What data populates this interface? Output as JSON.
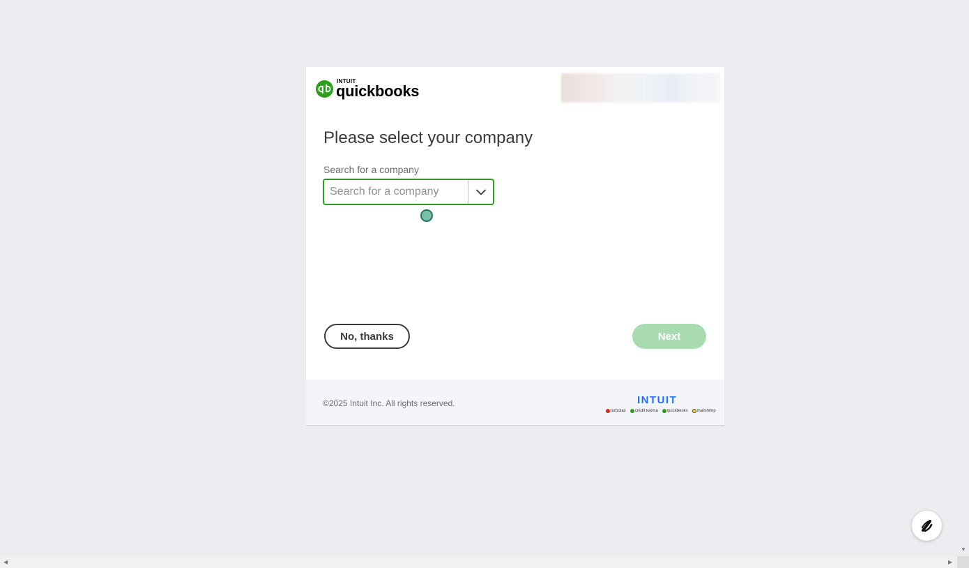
{
  "brand": {
    "parent": "INTUIT",
    "name": "quickbooks",
    "logo_icon": "qb-icon",
    "accent_color": "#2ca01c"
  },
  "page": {
    "title": "Please select your company"
  },
  "company_search": {
    "label": "Search for a company",
    "placeholder": "Search for a company",
    "value": "",
    "toggle_icon": "chevron-down-icon"
  },
  "actions": {
    "decline_label": "No, thanks",
    "next_label": "Next",
    "next_disabled": true
  },
  "footer": {
    "copyright": "©2025 Intuit Inc. All rights reserved.",
    "wordmark": "INTUIT",
    "family": [
      {
        "name": "turbotax",
        "color": "#d52b1e"
      },
      {
        "name": "credit karma",
        "color": "#2ca01c"
      },
      {
        "name": "quickbooks",
        "color": "#2ca01c"
      },
      {
        "name": "mailchimp",
        "color": "#ffe01b"
      }
    ]
  },
  "assistant": {
    "icon": "assistant-icon"
  }
}
